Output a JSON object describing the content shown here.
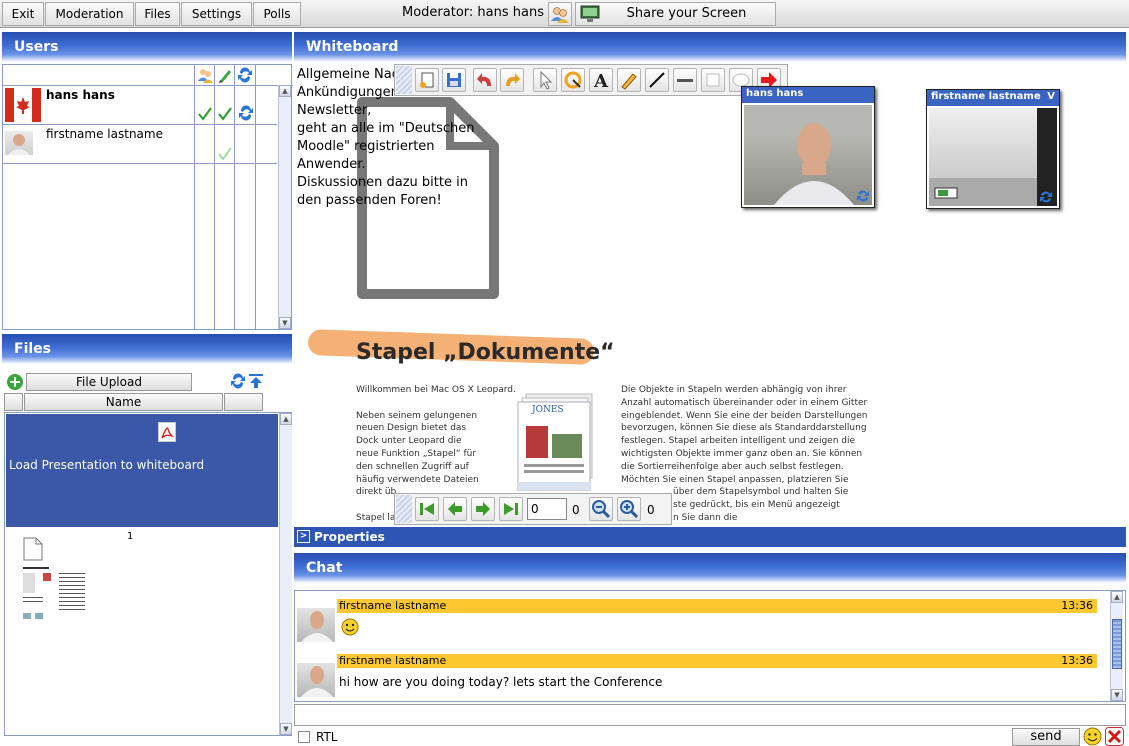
{
  "menu": {
    "exit": "Exit",
    "moderation": "Moderation",
    "files": "Files",
    "settings": "Settings",
    "polls": "Polls",
    "moderator_label": "Moderator: hans hans",
    "share_screen": "Share your Screen"
  },
  "users": {
    "title": "Users",
    "list": [
      {
        "name": "hans hans"
      },
      {
        "name": "firstname lastname"
      }
    ]
  },
  "files": {
    "title": "Files",
    "upload_label": "File Upload",
    "column_name": "Name",
    "selected_item_text": "Load Presentation to whiteboard",
    "page_number": "1"
  },
  "whiteboard": {
    "title": "Whiteboard",
    "text_lines": [
      "Allgemeine Nach",
      "Ankündigungen",
      "Newsletter,",
      "geht an alle im \"Deutschen",
      "Moodle\" registrierten",
      "Anwender.",
      "Diskussionen dazu bitte in",
      "den passenden Foren!"
    ],
    "doc_title": "Stapel „Dokumente“",
    "doc_col1": [
      "Willkommen bei Mac OS X Leopard.",
      "",
      "Neben seinem gelungenen",
      "neuen Design bietet das",
      "Dock unter Leopard die",
      "neue Funktion „Stapel“ für",
      "den schnellen Zugriff auf",
      "häufig verwendete Dateien",
      "direkt üb",
      "",
      "Stapel la"
    ],
    "doc_col2": [
      "Die Objekte in Stapeln werden abhängig von ihrer",
      "Anzahl automatisch übereinander oder in einem Gitter",
      "eingeblendet. Wenn Sie eine der beiden Darstellungen",
      "bevorzugen, können Sie diese als Standarddarstellung",
      "festlegen. Stapel arbeiten intelligent und zeigen die",
      "wichtigsten Objekte immer ganz oben an. Sie können",
      "die Sortierreihenfolge aber auch selbst festlegen.",
      "Möchten Sie einen Stapel anpassen, platzieren Sie",
      "über dem Stapelsymbol und halten Sie",
      "ste gedrückt, bis ein Menü angezeigt",
      "n Sie dann die"
    ],
    "doc_thumb_label": "JONES",
    "nav_page_value": "0",
    "nav_total": "0",
    "zoom_value": "0",
    "videos": [
      {
        "name": "hans hans"
      },
      {
        "name": "firstname lastname"
      }
    ],
    "properties_label": "Properties"
  },
  "chat": {
    "title": "Chat",
    "messages": [
      {
        "author": "firstname lastname",
        "time": "13:36",
        "text": ""
      },
      {
        "author": "firstname lastname",
        "time": "13:36",
        "text": "hi how are you doing today? lets start the Conference"
      }
    ],
    "rtl_label": "RTL",
    "send_label": "send"
  },
  "colors": {
    "header_blue": "#3f6ed3",
    "message_bar": "#fdc82f",
    "selection_blue": "#3b58a8"
  },
  "icons": {
    "share": "monitor-icon",
    "moderator": "users-icon",
    "pdf": "pdf-icon",
    "upload": "plus-icon",
    "smiley": "smiley-icon",
    "close": "close-icon"
  }
}
